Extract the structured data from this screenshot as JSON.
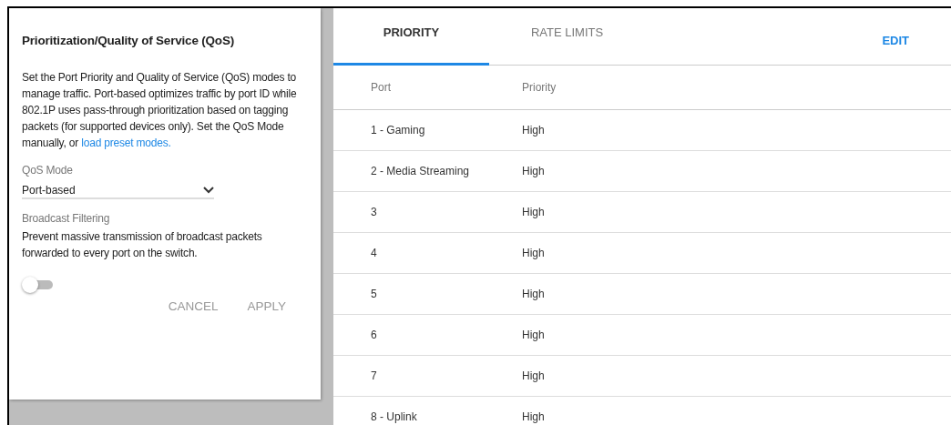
{
  "dialog": {
    "title": "Prioritization/Quality of Service (QoS)",
    "description": "Set the Port Priority and Quality of Service (QoS) modes to manage traffic. Port-based optimizes traffic by port ID while 802.1P uses pass-through prioritization based on tagging packets (for supported devices only). Set the QoS Mode manually, or ",
    "link": "load preset modes.",
    "qos_mode": {
      "label": "QoS Mode",
      "value": "Port-based"
    },
    "broadcast_filtering": {
      "label": "Broadcast Filtering",
      "description": "Prevent massive transmission of broadcast packets forwarded to every port on the switch.",
      "on": false
    },
    "buttons": [
      "CANCEL",
      "APPLY"
    ]
  },
  "tabs": [
    {
      "label": "PRIORITY",
      "selected": true
    },
    {
      "label": "RATE LIMITS",
      "selected": false
    }
  ],
  "edit_button": "EDIT",
  "table": {
    "columns": [
      "Port",
      "Priority"
    ],
    "rows": [
      [
        "1 - Gaming",
        "High"
      ],
      [
        "2 - Media Streaming",
        "High"
      ],
      [
        "3",
        "High"
      ],
      [
        "4",
        "High"
      ],
      [
        "5",
        "High"
      ],
      [
        "6",
        "High"
      ],
      [
        "7",
        "High"
      ],
      [
        "8 - Uplink",
        "High"
      ]
    ]
  }
}
